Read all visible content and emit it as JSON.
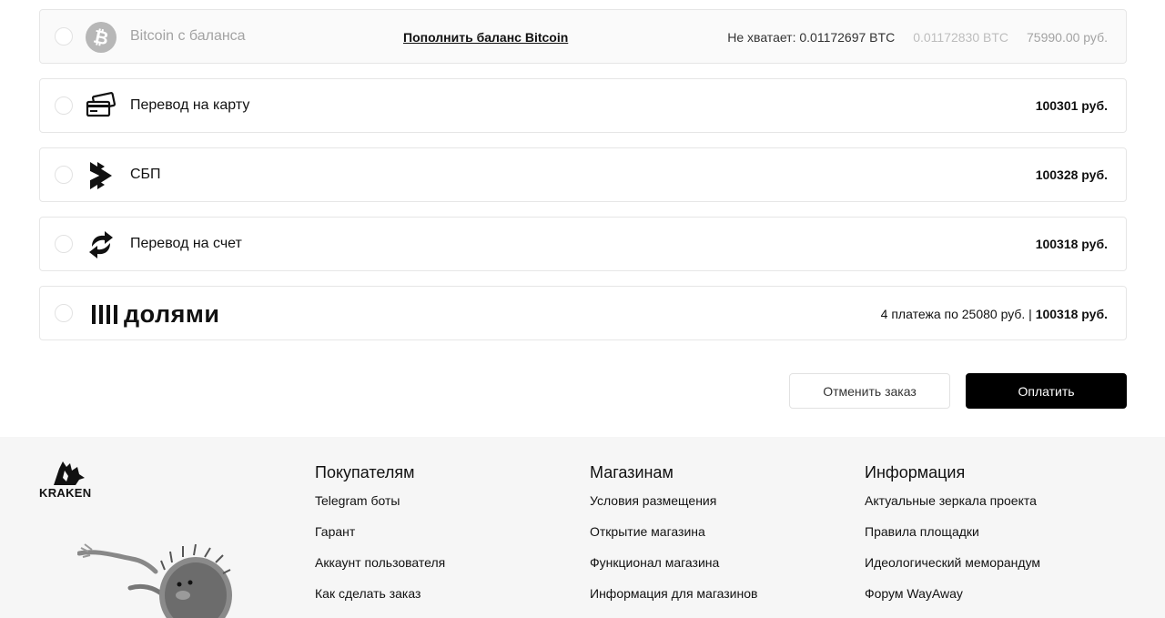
{
  "payment_methods": [
    {
      "id": "bitcoin",
      "label": "Bitcoin с баланса",
      "icon": "bitcoin-icon",
      "disabled": true,
      "topup_link": "Пополнить баланс Bitcoin",
      "missing": "Не хватает: 0.01172697 BTC",
      "btc_amount": "0.01172830 BTC",
      "price": "75990.00 руб."
    },
    {
      "id": "card",
      "label": "Перевод на карту",
      "icon": "cards-icon",
      "price": "100301 руб."
    },
    {
      "id": "sbp",
      "label": "СБП",
      "icon": "sbp-icon",
      "price": "100328 руб."
    },
    {
      "id": "account",
      "label": "Перевод на счет",
      "icon": "transfer-arrows-icon",
      "price": "100318 руб."
    },
    {
      "id": "dolyami",
      "logo_text": "долями",
      "icon": "dolyami-logo",
      "installments": "4 платежа по 25080 руб. |",
      "price": "100318 руб."
    }
  ],
  "actions": {
    "cancel_label": "Отменить заказ",
    "pay_label": "Оплатить"
  },
  "footer": {
    "logo_text": "KRAKEN",
    "columns": [
      {
        "title": "Покупателям",
        "links": [
          "Telegram боты",
          "Гарант",
          "Аккаунт пользователя",
          "Как сделать заказ"
        ]
      },
      {
        "title": "Магазинам",
        "links": [
          "Условия размещения",
          "Открытие магазина",
          "Функционал магазина",
          "Информация для магазинов"
        ]
      },
      {
        "title": "Информация",
        "links": [
          "Актуальные зеркала проекта",
          "Правила площадки",
          "Идеологический меморандум",
          "Форум WayAway"
        ]
      }
    ]
  },
  "colors": {
    "accent": "#000000",
    "border": "#e6e6e6",
    "disabled_text": "#a3a3a3",
    "footer_bg": "#f6f6f6",
    "bitcoin_icon_bg": "#b7b7b7"
  }
}
